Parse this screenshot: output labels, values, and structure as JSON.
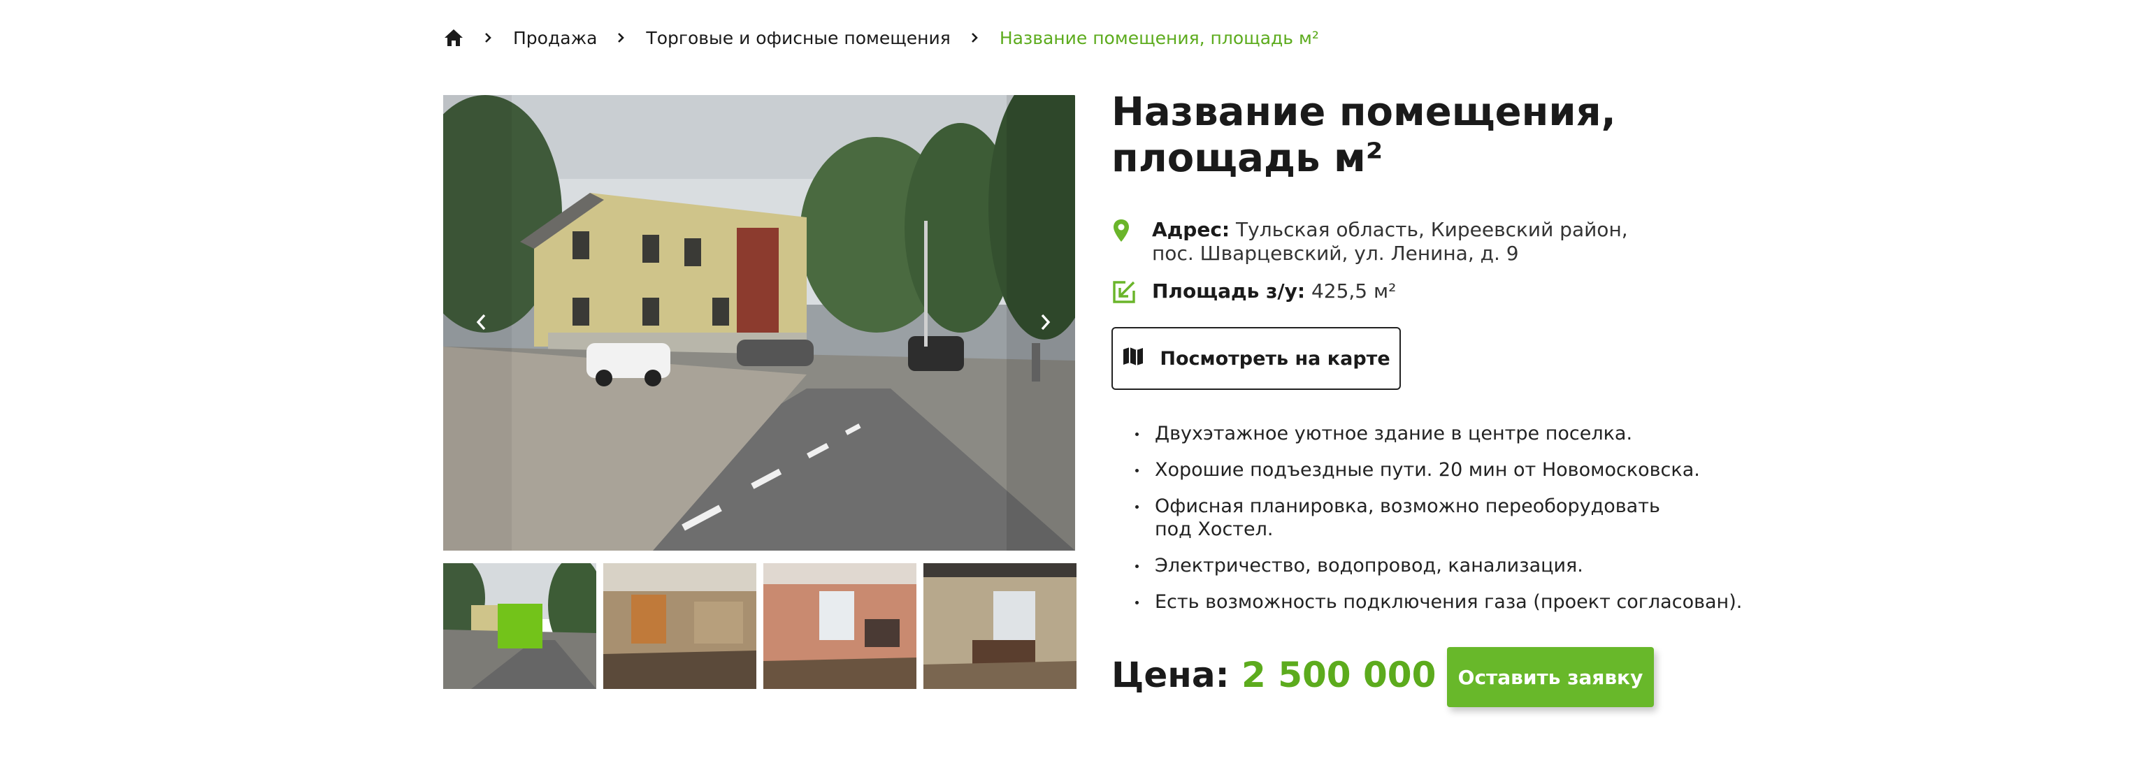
{
  "breadcrumb": {
    "items": [
      "Продажа",
      "Торговые и офисные помещения"
    ],
    "current": "Название помещения, площадь м²"
  },
  "title": "Название помещения, площадь м²",
  "address": {
    "label": "Адрес:",
    "line1": "Тульская область, Киреевский район,",
    "line2": "пос. Шварцевский, ул. Ленина, д. 9"
  },
  "area": {
    "label": "Площадь з/у:",
    "value": "425,5 м²"
  },
  "map_button": "Посмотреть на карте",
  "features": [
    "Двухэтажное уютное здание в центре поселка.",
    "Хорошие подъездные пути. 20 мин от Новомосковска.",
    "Офисная планировка, возможно переоборудовать",
    "под Хостел.",
    "Электричество, водопровод, канализация.",
    "Есть возможность подключения газа (проект согласован)."
  ],
  "price": {
    "label": "Цена:",
    "value": "2 500 000 ₽"
  },
  "order_button": "Оставить заявку",
  "icons": {
    "home": "home-icon",
    "location": "location-pin-icon",
    "area": "resize-arrow-icon",
    "map": "map-icon"
  },
  "colors": {
    "accent": "#5cab1d",
    "button": "#68b82a"
  }
}
